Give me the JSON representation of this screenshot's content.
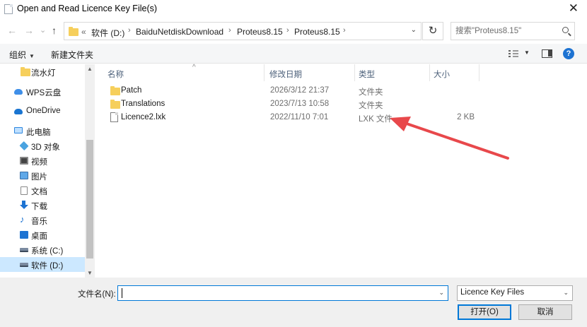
{
  "window": {
    "title": "Open and Read Licence Key File(s)",
    "close_glyph": "✕"
  },
  "nav": {
    "back": "←",
    "forward": "→",
    "dropdown": "⌄",
    "up": "↑"
  },
  "address": {
    "prefix": "«",
    "crumbs": [
      "软件 (D:)",
      "BaiduNetdiskDownload",
      "Proteus8.15",
      "Proteus8.15"
    ],
    "separator": "›",
    "dropdown": "⌄",
    "refresh": "↻"
  },
  "search": {
    "placeholder": "搜索\"Proteus8.15\""
  },
  "toolbar": {
    "organize": "组织",
    "organize_dd": "▼",
    "new_folder": "新建文件夹",
    "view_dd": "▼",
    "help": "?"
  },
  "sidebar": {
    "items": [
      {
        "label": "流水灯",
        "icon": "folder-icon"
      },
      {
        "label": "WPS云盘",
        "icon": "cloud-icon"
      },
      {
        "label": "OneDrive",
        "icon": "onedrive-icon"
      },
      {
        "label": "此电脑",
        "icon": "pc-icon"
      },
      {
        "label": "3D 对象",
        "icon": "3d-objects-icon"
      },
      {
        "label": "视频",
        "icon": "video-icon"
      },
      {
        "label": "图片",
        "icon": "pictures-icon"
      },
      {
        "label": "文档",
        "icon": "documents-icon"
      },
      {
        "label": "下载",
        "icon": "download-icon"
      },
      {
        "label": "音乐",
        "icon": "music-icon"
      },
      {
        "label": "桌面",
        "icon": "desktop-icon"
      },
      {
        "label": "系统 (C:)",
        "icon": "drive-icon"
      },
      {
        "label": "软件 (D:)",
        "icon": "drive-icon",
        "selected": true
      }
    ],
    "scroll_up": "▲",
    "scroll_down": "▼"
  },
  "columns": {
    "name": "名称",
    "modified": "修改日期",
    "type": "类型",
    "size": "大小",
    "sort": "^"
  },
  "files": [
    {
      "name": "Patch",
      "modified": "2026/3/12 21:37",
      "type": "文件夹",
      "size": "",
      "kind": "folder"
    },
    {
      "name": "Translations",
      "modified": "2023/7/13 10:58",
      "type": "文件夹",
      "size": "",
      "kind": "folder"
    },
    {
      "name": "Licence2.lxk",
      "modified": "2022/11/10 7:01",
      "type": "LXK 文件",
      "size": "2 KB",
      "kind": "file"
    }
  ],
  "annotation": {
    "arrow_color": "#e8484b"
  },
  "bottom": {
    "filename_label": "文件名(N):",
    "filename_value": "",
    "filename_dd": "⌄",
    "filter": "Licence Key Files",
    "filter_dd": "⌄",
    "open_label": "打开(O)",
    "cancel_label": "取消"
  }
}
